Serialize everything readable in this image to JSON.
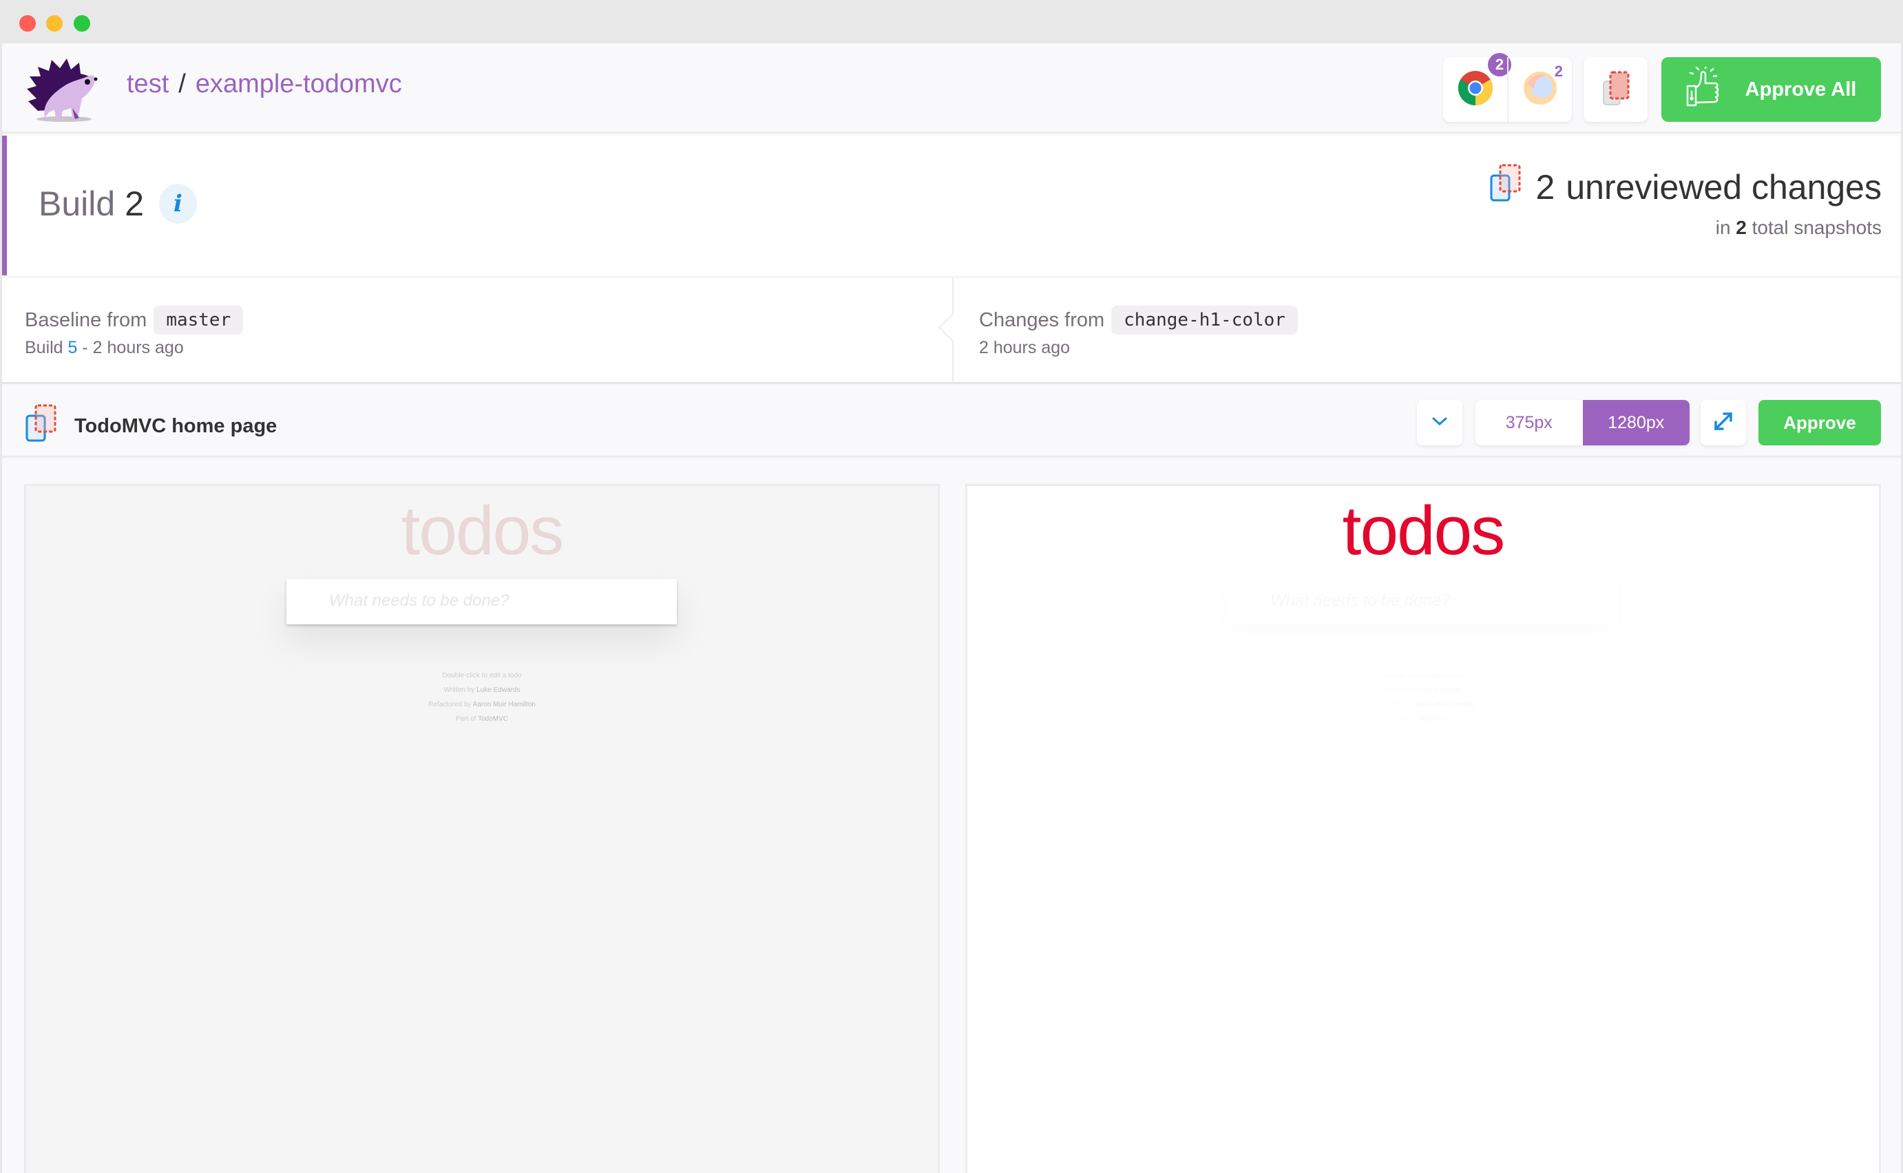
{
  "window": {
    "controls": [
      "close",
      "minimize",
      "maximize"
    ]
  },
  "header": {
    "org": "test",
    "separator": "/",
    "project": "example-todomvc",
    "browsers": [
      {
        "name": "chrome",
        "icon": "chrome-icon",
        "count": "2",
        "active": true
      },
      {
        "name": "firefox",
        "icon": "firefox-icon",
        "count": "2",
        "active": false
      }
    ],
    "diff_toggle_icon": "diff-overlay-icon",
    "approve_all_label": "Approve All"
  },
  "build": {
    "label": "Build",
    "number": "2",
    "info_icon": "i",
    "unreviewed_count": "2",
    "unreviewed_text": "unreviewed changes",
    "snapshots_prefix": "in",
    "snapshots_count": "2",
    "snapshots_suffix": "total snapshots"
  },
  "compare": {
    "baseline_label": "Baseline from",
    "baseline_branch": "master",
    "baseline_build_prefix": "Build",
    "baseline_build_number": "5",
    "baseline_time": "- 2 hours ago",
    "changes_label": "Changes from",
    "changes_branch": "change-h1-color",
    "changes_time": "2 hours ago"
  },
  "snapshot": {
    "title": "TodoMVC home page",
    "widths": [
      {
        "label": "375px",
        "active": false
      },
      {
        "label": "1280px",
        "active": true
      }
    ],
    "approve_label": "Approve"
  },
  "panes": {
    "baseline": {
      "heading": "todos",
      "input_placeholder": "What needs to be done?",
      "footer": {
        "line1": "Double-click to edit a todo",
        "line2_prefix": "Written by",
        "line2_name": "Luke Edwards",
        "line3_prefix": "Refactored by",
        "line3_name": "Aaron Muir Hamilton",
        "line4_prefix": "Part of",
        "line4_name": "TodoMVC"
      }
    },
    "changes": {
      "heading": "todos",
      "input_placeholder": "What needs to be done?",
      "footer": {
        "line1": "Double-click to edit a todo",
        "line2_prefix": "Written by",
        "line2_name": "Luke Edwards",
        "line3_prefix": "Refactored by",
        "line3_name": "Aaron Muir Hamilton",
        "line4_prefix": "Part of",
        "line4_name": "TodoMVC"
      }
    }
  },
  "colors": {
    "brand_purple": "#9b63bf",
    "approve_green": "#4bce5c",
    "link_blue": "#1a8ade",
    "diff_red": "#e3072e"
  }
}
